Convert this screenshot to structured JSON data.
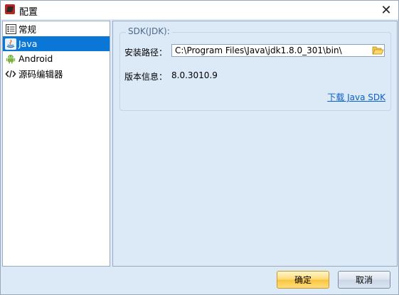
{
  "window": {
    "title": "配置",
    "close_glyph": "✕"
  },
  "sidebar": {
    "items": [
      {
        "label": "常规",
        "icon": "general-list-icon",
        "selected": false
      },
      {
        "label": "Java",
        "icon": "java-icon",
        "selected": true
      },
      {
        "label": "Android",
        "icon": "android-icon",
        "selected": false
      },
      {
        "label": "源码编辑器",
        "icon": "code-editor-icon",
        "selected": false
      }
    ]
  },
  "sdk": {
    "group_title": "SDK(JDK):",
    "install_path_label": "安装路径：",
    "install_path_value": "C:\\Program Files\\Java\\jdk1.8.0_301\\bin\\",
    "version_label": "版本信息：",
    "version_value": "8.0.3010.9",
    "download_link": "下载 Java SDK",
    "folder_icon": "folder-open-icon"
  },
  "buttons": {
    "ok": "确定",
    "cancel": "取消"
  },
  "colors": {
    "window_bg": "#dce9f7",
    "selection": "#0a77d7",
    "link": "#0a5fc8",
    "ok_button": "#ffd972"
  }
}
